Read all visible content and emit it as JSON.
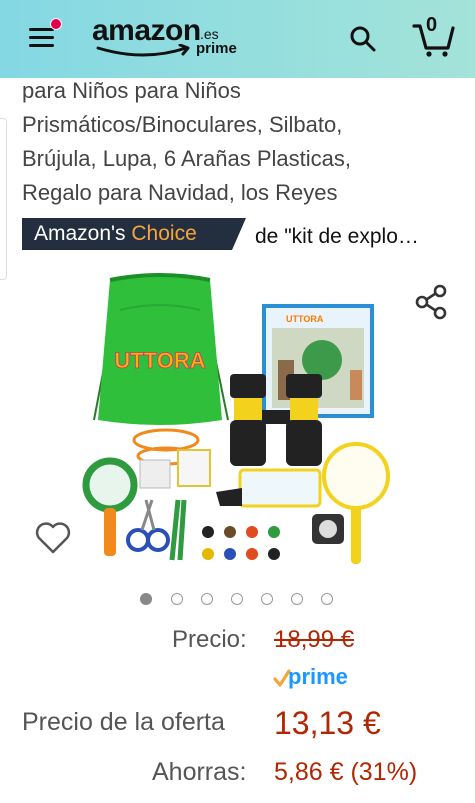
{
  "header": {
    "logo_word": "amazon",
    "logo_tld": ".es",
    "logo_prime": "prime",
    "cart_count": "0",
    "icons": [
      "menu-icon",
      "search-icon",
      "cart-icon"
    ]
  },
  "product": {
    "title_lines": [
      "para Niños para Niños",
      "Prismáticos/Binoculares, Silbato,",
      "Brújula, Lupa, 6 Arañas Plasticas,",
      "Regalo para Navidad, los Reyes"
    ],
    "badge_part1": "Amazon's ",
    "badge_part2": "Choice",
    "badge_query": "de \"kit de explo…",
    "bag_brand": "UTTORA",
    "box_brand": "UTTORA",
    "image_count": 7,
    "active_image": 0
  },
  "pricing": {
    "price_label": "Precio:",
    "price_old": "18,99 €",
    "prime_text": "prime",
    "offer_label": "Precio de la oferta",
    "offer_price": "13,13 €",
    "save_label": "Ahorras:",
    "save_value": "5,86 € (31%)"
  },
  "colors": {
    "header_start": "#84d8e3",
    "header_end": "#a3e3d9",
    "badge_bg": "#232f3e",
    "badge_accent": "#f6a43b",
    "price_red": "#b12704",
    "prime_blue": "#1a98ff",
    "notification_dot": "#e5004f"
  }
}
